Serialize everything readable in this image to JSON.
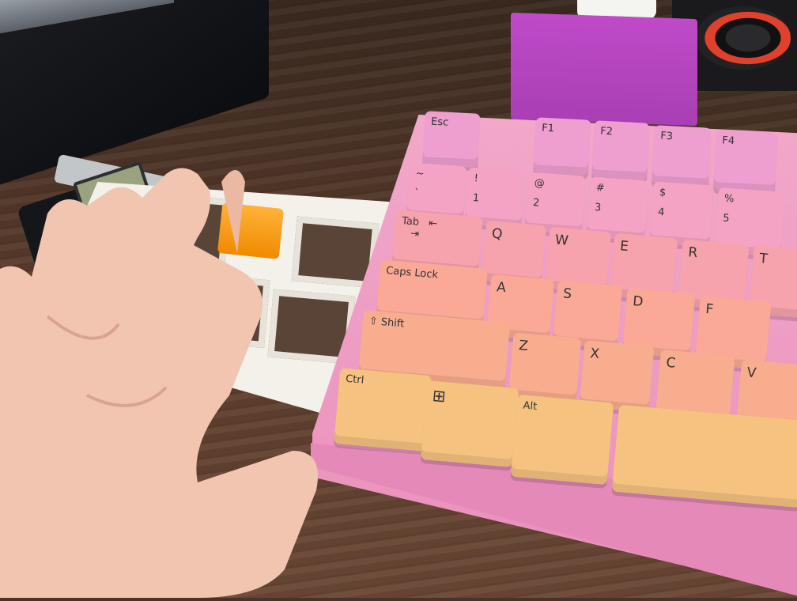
{
  "scene": {
    "colors": {
      "desk": "#5a3c2c",
      "keyboard_case": "#ef9cc6",
      "stand": "#b645bf",
      "macropad_case": "#f4f1ea",
      "macropad_key": "#f59a12",
      "skin": "#f2c5b1"
    }
  },
  "calipers": {
    "icon": "digital-calipers"
  },
  "keyboard": {
    "keys": {
      "esc": "Esc",
      "f1": "F1",
      "f2": "F2",
      "f3": "F3",
      "f4": "F4",
      "tilde_top": "~",
      "tilde_bottom": "`",
      "one_top": "!",
      "one_bottom": "1",
      "two_top": "@",
      "two_bottom": "2",
      "three_top": "#",
      "three_bottom": "3",
      "four_top": "$",
      "four_bottom": "4",
      "five_top": "%",
      "five_bottom": "5",
      "tab": "Tab",
      "q": "Q",
      "w": "W",
      "e": "E",
      "r": "R",
      "t": "T",
      "caps": "Caps Lock",
      "a": "A",
      "s": "S",
      "d": "D",
      "f": "F",
      "shift": "Shift",
      "z": "Z",
      "x": "X",
      "c": "C",
      "v": "V",
      "ctrl": "Ctrl",
      "alt": "Alt"
    }
  }
}
